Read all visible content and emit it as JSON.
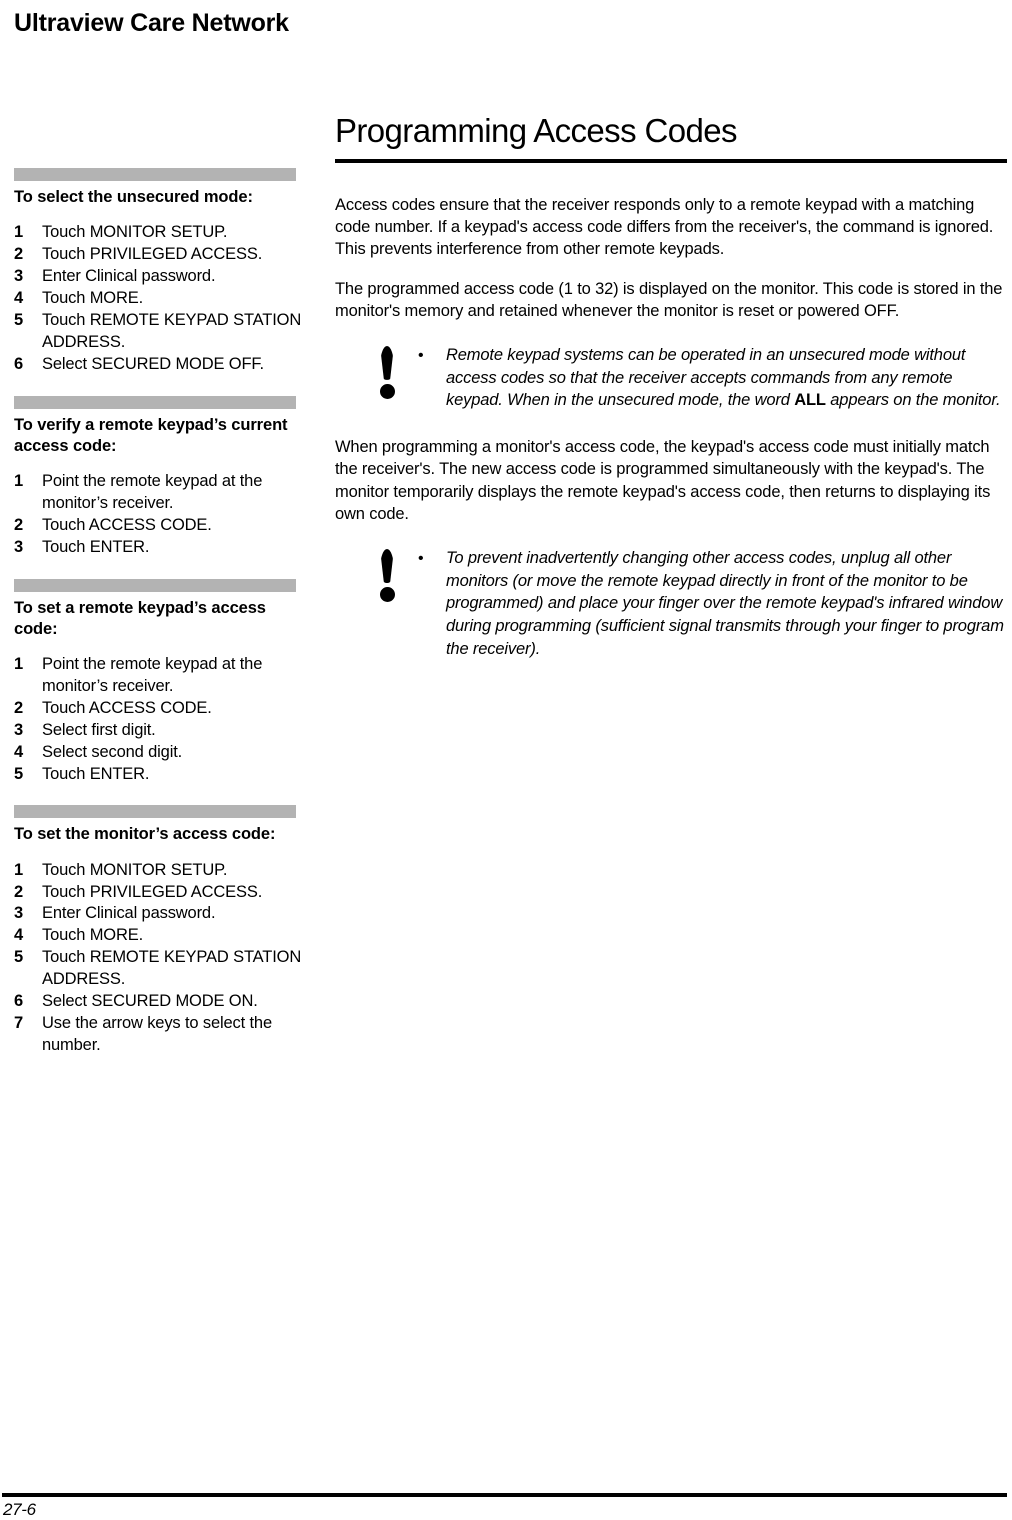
{
  "header": {
    "running_head": "Ultraview Care Network"
  },
  "main": {
    "title": "Programming Access Codes",
    "paragraphs": [
      "Access codes ensure that the receiver responds only to a remote keypad with a matching code number. If a keypad's access code differs from the receiver's, the command is ignored. This prevents interference from other remote keypads.",
      "The programmed access code (1 to 32) is displayed on the monitor. This code is stored in the monitor's memory and retained whenever the monitor is reset or powered OFF.",
      "When programming a monitor's access code, the keypad's access code must initially match the receiver's. The new access code is programmed simultaneously with the keypad's. The monitor temporarily displays the remote keypad's access code, then returns to displaying its own code."
    ],
    "notes": [
      {
        "icon": "exclamation-icon",
        "bullet": "•",
        "text_before": "Remote keypad systems can be operated in an unsecured mode without access codes so that the receiver accepts commands from any remote keypad. When in the unsecured mode, the word ",
        "emphasis": "ALL",
        "text_after": " appears on the monitor."
      },
      {
        "icon": "exclamation-icon",
        "bullet": "•",
        "text_before": "To prevent inadvertently changing other access codes, unplug all other monitors (or move the remote keypad directly in front of the monitor to be programmed) and place your finger over the remote keypad's infrared window during programming (sufficient signal transmits through your finger to program the receiver).",
        "emphasis": "",
        "text_after": ""
      }
    ]
  },
  "sidebar": {
    "procedures": [
      {
        "heading": "To select the unsecured mode:",
        "steps": [
          {
            "num": "1",
            "text": "Touch MONITOR SETUP."
          },
          {
            "num": "2",
            "text": "Touch PRIVILEGED ACCESS."
          },
          {
            "num": "3",
            "text": "Enter Clinical password."
          },
          {
            "num": "4",
            "text": "Touch MORE."
          },
          {
            "num": "5",
            "text": "Touch REMOTE KEYPAD STATION ADDRESS."
          },
          {
            "num": "6",
            "text": "Select SECURED MODE OFF."
          }
        ]
      },
      {
        "heading": "To verify a remote keypad’s current access code:",
        "steps": [
          {
            "num": "1",
            "text": "Point the remote keypad at the monitor’s receiver."
          },
          {
            "num": "2",
            "text": "Touch ACCESS CODE."
          },
          {
            "num": "3",
            "text": "Touch ENTER."
          }
        ]
      },
      {
        "heading": "To set a remote keypad’s access code:",
        "steps": [
          {
            "num": "1",
            "text": "Point the remote keypad at the monitor’s receiver."
          },
          {
            "num": "2",
            "text": "Touch ACCESS CODE."
          },
          {
            "num": "3",
            "text": "Select first digit."
          },
          {
            "num": "4",
            "text": "Select second digit."
          },
          {
            "num": "5",
            "text": "Touch ENTER."
          }
        ]
      },
      {
        "heading": "To set the monitor’s access code:",
        "steps": [
          {
            "num": "1",
            "text": "Touch MONITOR SETUP."
          },
          {
            "num": "2",
            "text": "Touch PRIVILEGED ACCESS."
          },
          {
            "num": "3",
            "text": "Enter Clinical password."
          },
          {
            "num": "4",
            "text": "Touch MORE."
          },
          {
            "num": "5",
            "text": "Touch REMOTE KEYPAD STATION ADDRESS."
          },
          {
            "num": "6",
            "text": "Select SECURED MODE ON."
          },
          {
            "num": "7",
            "text": "Use the arrow keys to select the number."
          }
        ]
      }
    ]
  },
  "footer": {
    "page_number": "27-6"
  },
  "colors": {
    "gray_bar": "#b3b3b3",
    "text": "#000000",
    "background": "#ffffff"
  }
}
